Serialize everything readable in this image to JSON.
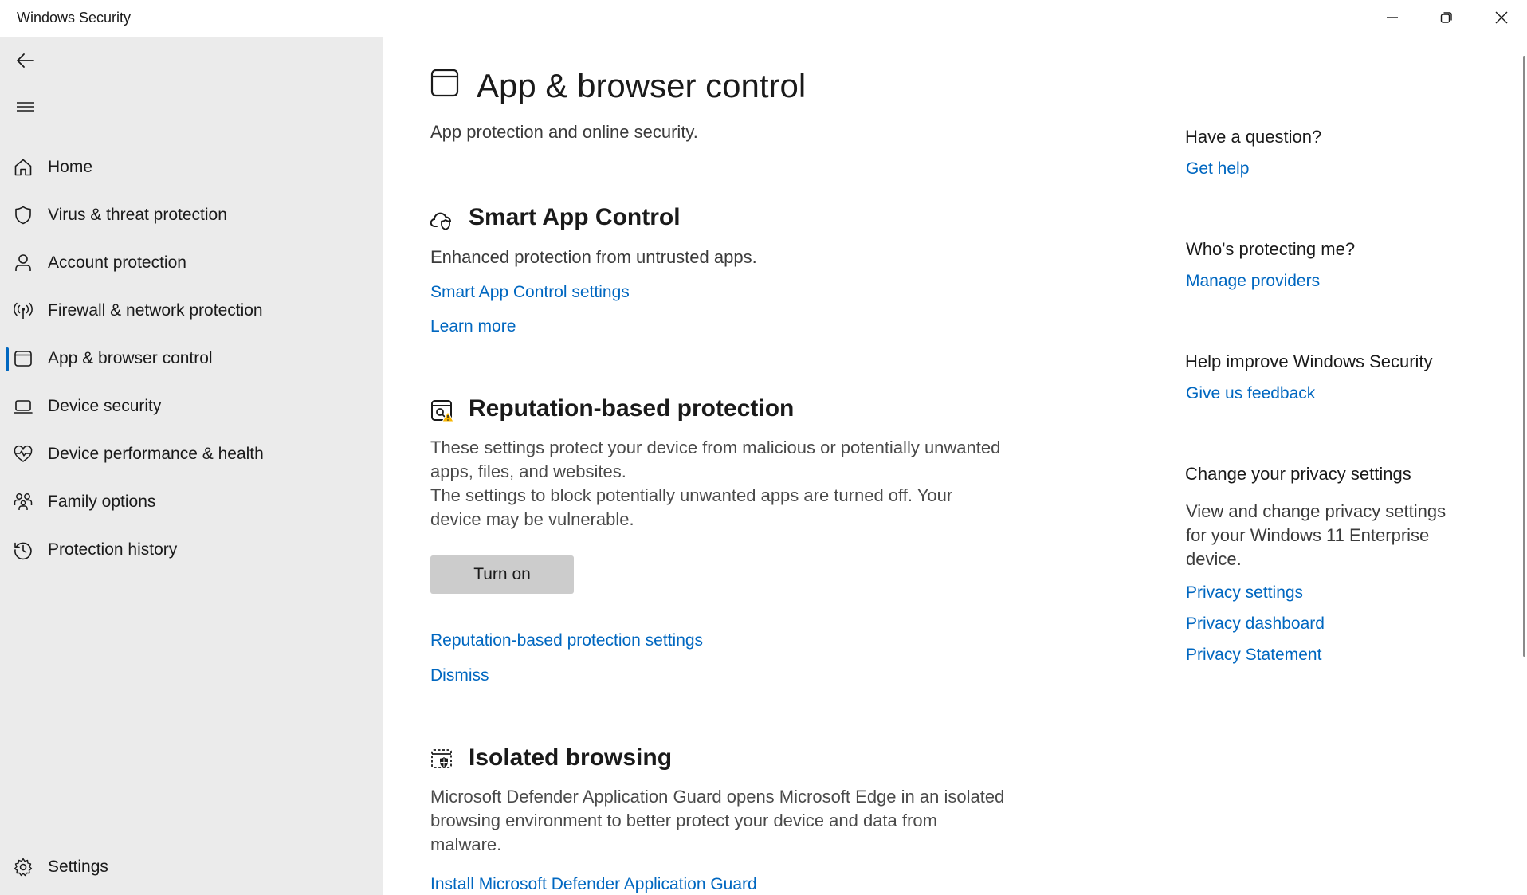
{
  "window": {
    "title": "Windows Security"
  },
  "sidebar": {
    "items": [
      {
        "label": "Home",
        "icon": "home-icon"
      },
      {
        "label": "Virus & threat protection",
        "icon": "shield-icon"
      },
      {
        "label": "Account protection",
        "icon": "person-icon"
      },
      {
        "label": "Firewall & network protection",
        "icon": "antenna-icon"
      },
      {
        "label": "App & browser control",
        "icon": "app-window-icon",
        "selected": true
      },
      {
        "label": "Device security",
        "icon": "laptop-icon"
      },
      {
        "label": "Device performance & health",
        "icon": "heart-pulse-icon"
      },
      {
        "label": "Family options",
        "icon": "family-icon"
      },
      {
        "label": "Protection history",
        "icon": "history-icon"
      }
    ],
    "settings_label": "Settings"
  },
  "main": {
    "title": "App & browser control",
    "subtitle": "App protection and online security.",
    "smart_app": {
      "heading": "Smart App Control",
      "description": "Enhanced protection from untrusted apps.",
      "settings_link": "Smart App Control settings",
      "learn_more": "Learn more"
    },
    "reputation": {
      "heading": "Reputation-based protection",
      "description1": "These settings protect your device from malicious or potentially unwanted apps, files, and websites.",
      "description2": "The settings to block potentially unwanted apps are turned off. Your device may be vulnerable.",
      "button": "Turn on",
      "settings_link": "Reputation-based protection settings",
      "dismiss": "Dismiss"
    },
    "isolated": {
      "heading": "Isolated browsing",
      "description": "Microsoft Defender Application Guard opens Microsoft Edge in an isolated browsing environment to better protect your device and data from malware.",
      "install_link": "Install Microsoft Defender Application Guard"
    }
  },
  "right": {
    "question": {
      "heading": "Have a question?",
      "link": "Get help"
    },
    "protecting": {
      "heading": "Who's protecting me?",
      "link": "Manage providers"
    },
    "improve": {
      "heading": "Help improve Windows Security",
      "link": "Give us feedback"
    },
    "privacy": {
      "heading": "Change your privacy settings",
      "description": "View and change privacy settings for your Windows 11 Enterprise device.",
      "links": [
        "Privacy settings",
        "Privacy dashboard",
        "Privacy Statement"
      ]
    }
  },
  "colors": {
    "accent": "#0067c0",
    "sidebar_bg": "#ebebeb",
    "warning": "#f7b500"
  }
}
